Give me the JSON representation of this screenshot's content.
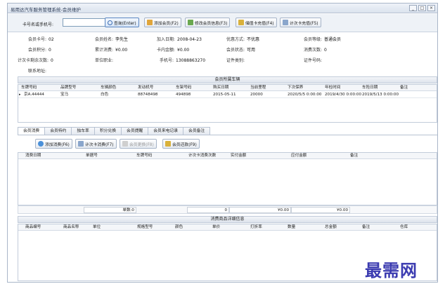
{
  "window": {
    "title": "易用达汽车服务管理系统-会员维护",
    "controls": [
      "_",
      "□",
      "×"
    ]
  },
  "search": {
    "label": "卡号名或手机号:",
    "value": "",
    "buttons": {
      "query": "查询(Enter)",
      "add_member": "添加会员(F2)",
      "edit_member": "修改会员信息(F3)",
      "topup": "储值卡充值(F4)",
      "count_topup": "计次卡充值(F5)"
    }
  },
  "member": {
    "card_no": {
      "label": "会员卡号:",
      "value": "02"
    },
    "name": {
      "label": "会员姓名:",
      "value": "李先生"
    },
    "join_date": {
      "label": "加入日期:",
      "value": "2008-04-23"
    },
    "discount": {
      "label": "优惠方式:",
      "value": "不优惠"
    },
    "level": {
      "label": "会员等级:",
      "value": "普通会员"
    },
    "points": {
      "label": "会员积分:",
      "value": "0"
    },
    "total_spent": {
      "label": "累计消费:",
      "value": "¥0.00"
    },
    "card_balance": {
      "label": "卡内金额:",
      "value": "¥0.00"
    },
    "status": {
      "label": "会员状态:",
      "value": "可用"
    },
    "consume_count": {
      "label": "消费次数:",
      "value": "0"
    },
    "count_remaining": {
      "label": "计次卡剩余次数:",
      "value": "0"
    },
    "employer": {
      "label": "单位职业:",
      "value": ""
    },
    "phone": {
      "label": "手机号:",
      "value": "13088863270"
    },
    "id_type": {
      "label": "证件类别:",
      "value": ""
    },
    "id_no": {
      "label": "证件号码:",
      "value": ""
    },
    "address": {
      "label": "联系地址:",
      "value": ""
    }
  },
  "vehicles": {
    "section_title": "会员所属车辆",
    "columns": [
      "车牌号码",
      "品牌型号",
      "车辆颜色",
      "发动机号",
      "车架号码",
      "购买日期",
      "当前里程",
      "下次保养",
      "年检时间",
      "车险日期",
      "备注"
    ],
    "rows": [
      {
        "marker": "▸",
        "cells": [
          "京A.44444",
          "宝马",
          "白色",
          "88748498",
          "494898",
          "2015-05-11",
          "20000",
          "2020/5/5 0:00:00",
          "2019/4/30 0:00:00",
          "2019/5/13 0:00:00",
          ""
        ]
      }
    ]
  },
  "tabs": [
    {
      "label": "会员消费",
      "active": true
    },
    {
      "label": "会员特约",
      "active": false
    },
    {
      "label": "独车率",
      "active": false
    },
    {
      "label": "积分兑换",
      "active": false
    },
    {
      "label": "会员提醒",
      "active": false
    },
    {
      "label": "会员来电记录",
      "active": false
    },
    {
      "label": "会员备注",
      "active": false
    }
  ],
  "consume_actions": {
    "add": "添加消费(F6)",
    "count_consume": "计次卡消费(F7)",
    "change": "会员更换(F8)",
    "refund": "会员还款(F9)"
  },
  "consume": {
    "columns": [
      "消费日期",
      "单据号",
      "车牌号码",
      "计次卡消费次数",
      "实付金额",
      "应付金额",
      "备注"
    ],
    "summary": {
      "count_label": "单数:0",
      "count_total": "0",
      "paid_total": "¥0.00",
      "due_total": "¥0.00"
    }
  },
  "details": {
    "section_title": "消费商品详细信息",
    "columns": [
      "商品编号",
      "商品名称",
      "单位",
      "规格型号",
      "颜色",
      "单价",
      "打折率",
      "数量",
      "总金额",
      "备注",
      "仓库"
    ]
  },
  "watermark": "最需网",
  "colors": {
    "accent": "#5b86c2",
    "border": "#c2ccda",
    "watermark": "#3b3bb0"
  }
}
